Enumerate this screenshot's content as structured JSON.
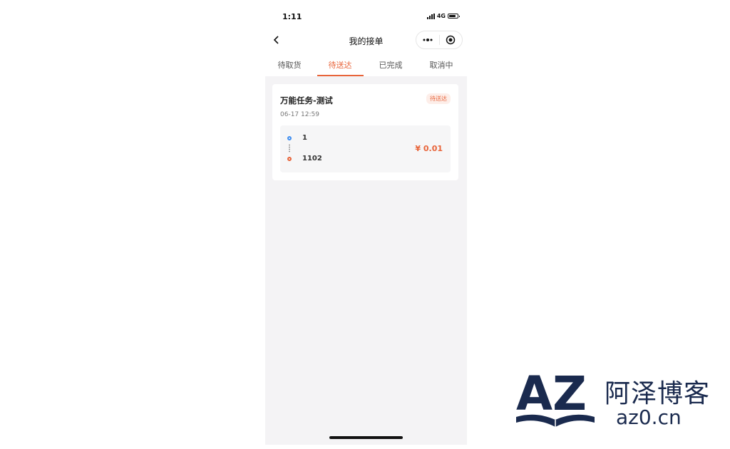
{
  "status_bar": {
    "time": "1:11",
    "network": "4G"
  },
  "nav": {
    "title": "我的接单",
    "back_icon": "chevron-left-icon",
    "more_icon": "more-dots-icon",
    "close_icon": "target-circle-icon"
  },
  "tabs": [
    {
      "label": "待取货",
      "active": false
    },
    {
      "label": "待送达",
      "active": true
    },
    {
      "label": "已完成",
      "active": false
    },
    {
      "label": "取消中",
      "active": false
    }
  ],
  "order": {
    "title": "万能任务-测试",
    "status": "待送达",
    "time": "06-17 12:59",
    "from": "1",
    "to": "1102",
    "price": "¥ 0.01"
  },
  "colors": {
    "accent": "#e8643a",
    "from_dot": "#3f8ef0",
    "logo": "#1a2a4e"
  },
  "watermark": {
    "name": "阿泽博客",
    "url": "az0.cn",
    "mark": "AZ"
  }
}
